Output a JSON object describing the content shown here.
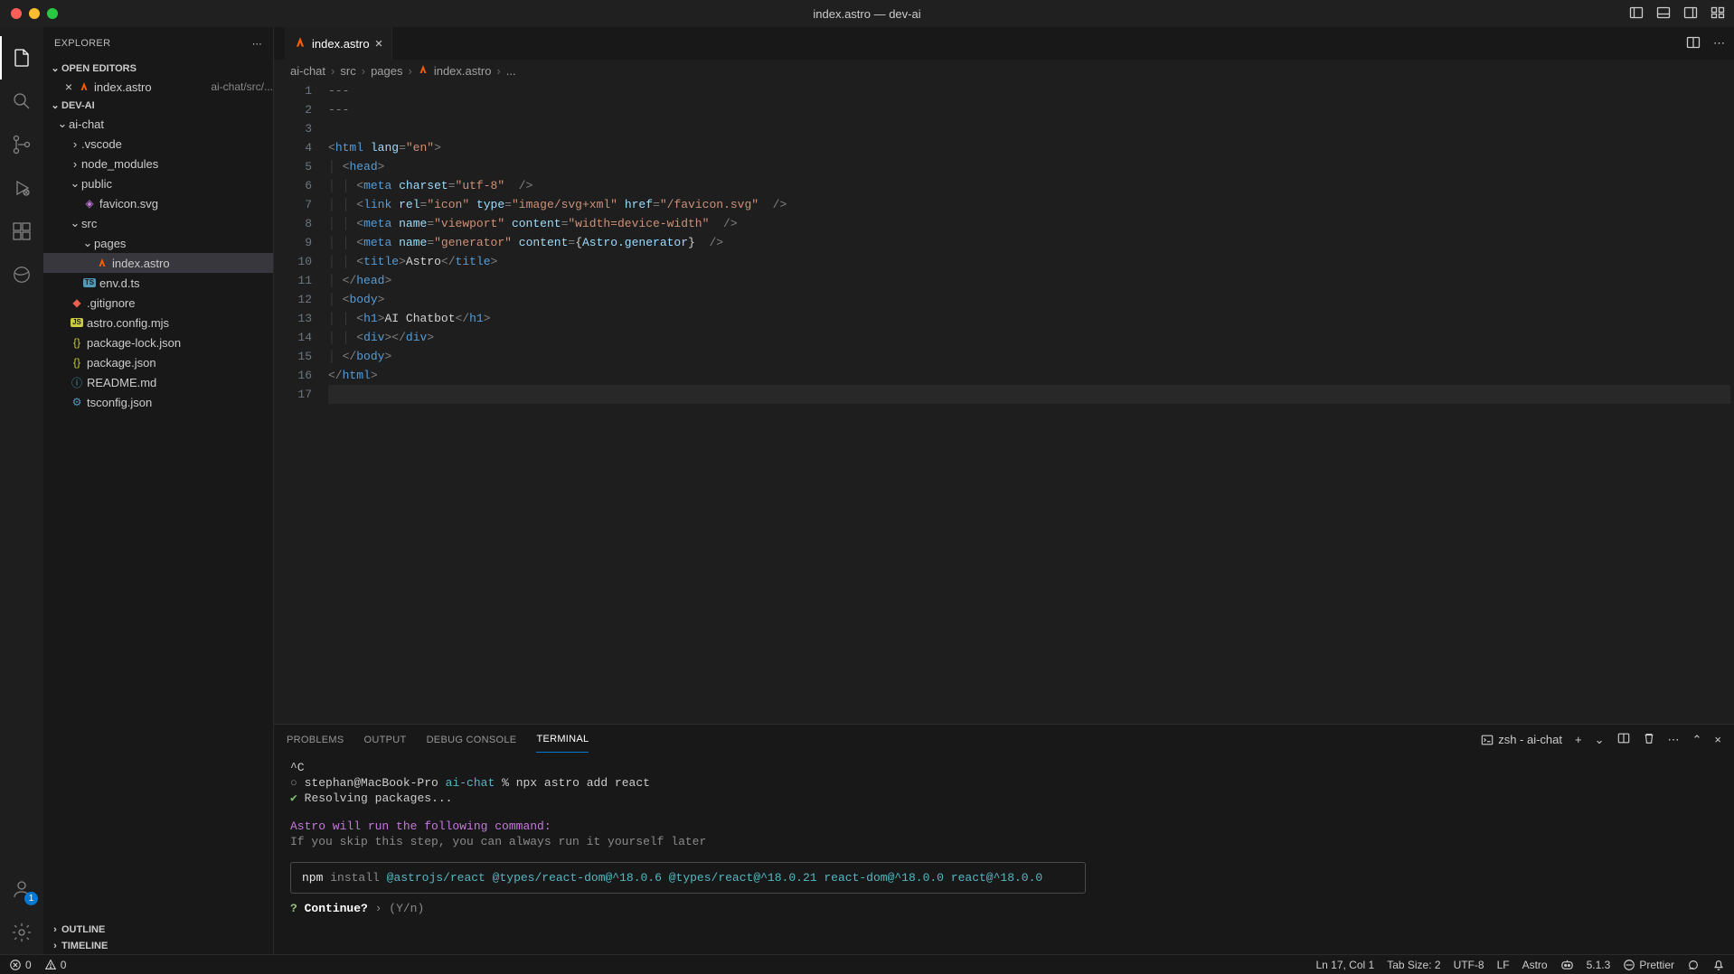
{
  "window": {
    "title": "index.astro — dev-ai"
  },
  "sidebar": {
    "title": "EXPLORER",
    "sections": {
      "open_editors": "OPEN EDITORS",
      "workspace": "DEV-AI",
      "outline": "OUTLINE",
      "timeline": "TIMELINE"
    },
    "open_editor": {
      "name": "index.astro",
      "desc": "ai-chat/src/..."
    },
    "tree": {
      "root": "ai-chat",
      "folders": {
        "vscode": ".vscode",
        "node_modules": "node_modules",
        "public": "public",
        "src": "src",
        "pages": "pages"
      },
      "files": {
        "favicon": "favicon.svg",
        "index": "index.astro",
        "envdts": "env.d.ts",
        "gitignore": ".gitignore",
        "astroconfig": "astro.config.mjs",
        "pkglock": "package-lock.json",
        "pkg": "package.json",
        "readme": "README.md",
        "tsconfig": "tsconfig.json"
      }
    }
  },
  "tabs": {
    "active": "index.astro"
  },
  "breadcrumb": {
    "parts": [
      "ai-chat",
      "src",
      "pages",
      "index.astro",
      "..."
    ]
  },
  "code": {
    "lines": [
      "---",
      "---",
      "",
      "<html lang=\"en\">",
      "  <head>",
      "    <meta charset=\"utf-8\" />",
      "    <link rel=\"icon\" type=\"image/svg+xml\" href=\"/favicon.svg\" />",
      "    <meta name=\"viewport\" content=\"width=device-width\" />",
      "    <meta name=\"generator\" content={Astro.generator} />",
      "    <title>Astro</title>",
      "  </head>",
      "  <body>",
      "    <h1>AI Chatbot</h1>",
      "    <div></div>",
      "  </body>",
      "</html>",
      ""
    ]
  },
  "panel": {
    "tabs": {
      "problems": "PROBLEMS",
      "output": "OUTPUT",
      "debug": "DEBUG CONSOLE",
      "terminal": "TERMINAL"
    },
    "term_label": "zsh - ai-chat",
    "terminal": {
      "line1": "^C",
      "prompt_user": "stephan@MacBook-Pro",
      "prompt_dir": "ai-chat",
      "prompt_sym": "%",
      "cmd": "npx astro add react",
      "resolving": "Resolving packages...",
      "msg1": "Astro will run the following command:",
      "msg2": "If you skip this step, you can always run it yourself later",
      "npm": "npm",
      "install": "install",
      "pkg1": "@astrojs/react",
      "pkg2": "@types/react-dom@^18.0.6",
      "pkg3": "@types/react@^18.0.21",
      "pkg4": "react-dom@^18.0.0",
      "pkg5": "react@^18.0.0",
      "continue_q": "?",
      "continue_label": "Continue?",
      "continue_sep": "›",
      "continue_opts": "(Y/n)"
    }
  },
  "status": {
    "errors": "0",
    "warnings": "0",
    "cursor": "Ln 17, Col 1",
    "tabsize": "Tab Size: 2",
    "encoding": "UTF-8",
    "eol": "LF",
    "language": "Astro",
    "version": "5.1.3",
    "prettier": "Prettier"
  },
  "account_badge": "1"
}
